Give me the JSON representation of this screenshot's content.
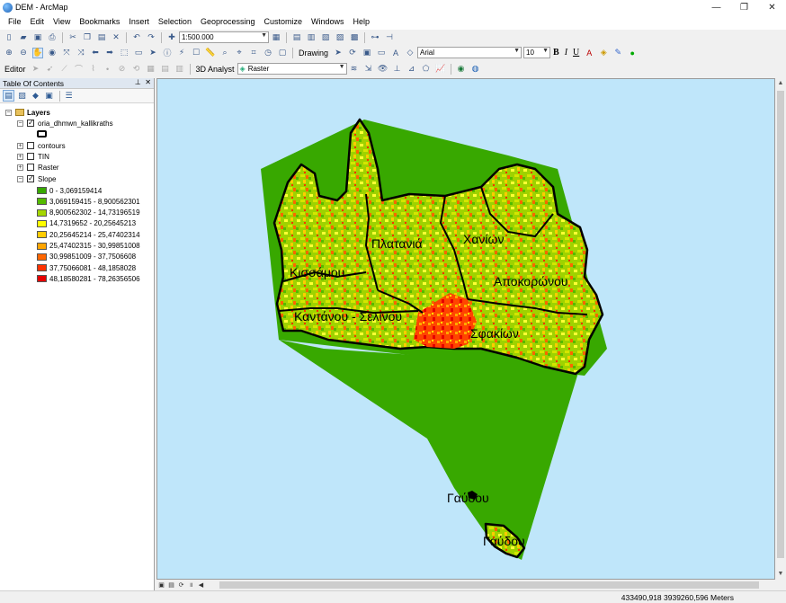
{
  "window": {
    "title": "DEM - ArcMap",
    "minimize": "—",
    "restore": "❐",
    "close": "✕"
  },
  "menu": [
    "File",
    "Edit",
    "View",
    "Bookmarks",
    "Insert",
    "Selection",
    "Geoprocessing",
    "Customize",
    "Windows",
    "Help"
  ],
  "toolbar": {
    "scale": "1:500.000",
    "drawing_label": "Drawing",
    "font_name": "Arial",
    "font_size": "10",
    "bold": "B",
    "italic": "I",
    "underline": "U",
    "editor_label": "Editor",
    "analyst_label": "3D Analyst",
    "analyst_layer": "Raster"
  },
  "toc": {
    "title": "Table Of Contents",
    "root": "Layers",
    "layers": [
      {
        "name": "oria_dhmwn_kallikraths",
        "checked": true,
        "expanded": true
      },
      {
        "name": "contours",
        "checked": false,
        "expanded": false
      },
      {
        "name": "TIN",
        "checked": false,
        "expanded": false
      },
      {
        "name": "Raster",
        "checked": false,
        "expanded": false
      },
      {
        "name": "Slope",
        "checked": true,
        "expanded": true
      }
    ],
    "legend": [
      {
        "label": "0 - 3,069159414",
        "color": "#38a800"
      },
      {
        "label": "3,069159415 - 8,900562301",
        "color": "#55bb00"
      },
      {
        "label": "8,900562302 - 14,73196519",
        "color": "#a4d600"
      },
      {
        "label": "14,7319652 - 20,25645213",
        "color": "#ffff00"
      },
      {
        "label": "20,25645214 - 25,47402314",
        "color": "#ffcc00"
      },
      {
        "label": "25,47402315 - 30,99851008",
        "color": "#ffa500"
      },
      {
        "label": "30,99851009 - 37,7506608",
        "color": "#ff6600"
      },
      {
        "label": "37,75066081 - 48,1858028",
        "color": "#ff3300"
      },
      {
        "label": "48,18580281 - 78,26356506",
        "color": "#e60000"
      }
    ]
  },
  "map": {
    "labels": [
      "Πλατανιά",
      "Χανίων",
      "Κισσάμου",
      "Αποκορώνου",
      "Καντάνου - Σελίνου",
      "Σφακίων",
      "Γαύδου",
      "Γαύδου"
    ],
    "sea_color": "#bfe6fa",
    "extent_color": "#38a800"
  },
  "status": {
    "coordinates": "433490,918  3939260,596 Meters"
  }
}
